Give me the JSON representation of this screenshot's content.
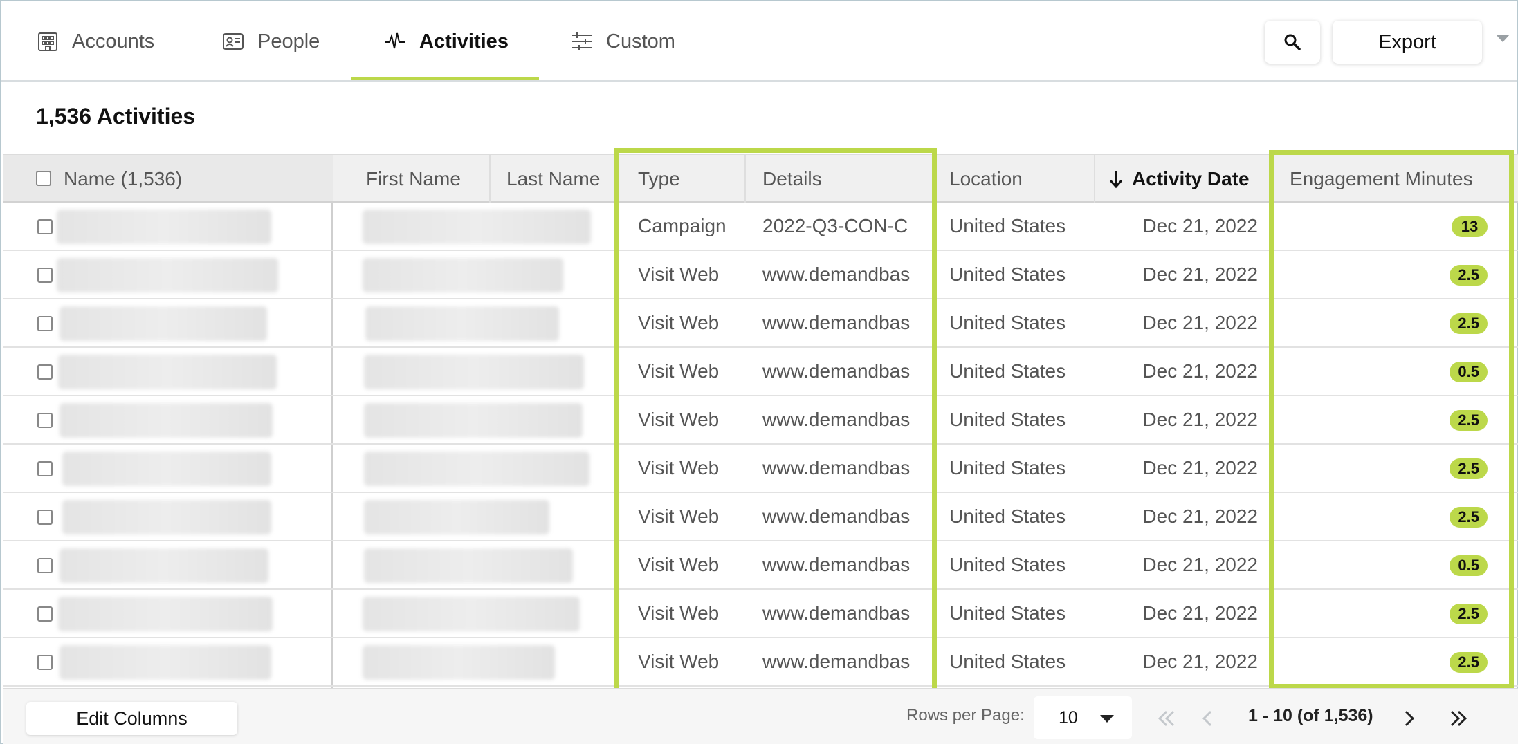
{
  "tabs": [
    {
      "label": "Accounts",
      "icon": "building-icon",
      "active": false
    },
    {
      "label": "People",
      "icon": "id-card-icon",
      "active": false
    },
    {
      "label": "Activities",
      "icon": "activity-pulse-icon",
      "active": true
    },
    {
      "label": "Custom",
      "icon": "sliders-icon",
      "active": false
    }
  ],
  "toolbar": {
    "export_label": "Export",
    "search_icon": "search-icon"
  },
  "page_title": "1,536 Activities",
  "columns": {
    "name": "Name (1,536)",
    "first_name": "First Name",
    "last_name": "Last Name",
    "type": "Type",
    "details": "Details",
    "location": "Location",
    "activity_date": "Activity Date",
    "engagement": "Engagement Minutes"
  },
  "sort": {
    "column": "Activity Date",
    "direction": "descending"
  },
  "rows": [
    {
      "type": "Campaign",
      "details": "2022-Q3-CON-C",
      "location": "United States",
      "date": "Dec 21, 2022",
      "minutes": "13"
    },
    {
      "type": "Visit Web",
      "details": "www.demandbas",
      "location": "United States",
      "date": "Dec 21, 2022",
      "minutes": "2.5"
    },
    {
      "type": "Visit Web",
      "details": "www.demandbas",
      "location": "United States",
      "date": "Dec 21, 2022",
      "minutes": "2.5"
    },
    {
      "type": "Visit Web",
      "details": "www.demandbas",
      "location": "United States",
      "date": "Dec 21, 2022",
      "minutes": "0.5"
    },
    {
      "type": "Visit Web",
      "details": "www.demandbas",
      "location": "United States",
      "date": "Dec 21, 2022",
      "minutes": "2.5"
    },
    {
      "type": "Visit Web",
      "details": "www.demandbas",
      "location": "United States",
      "date": "Dec 21, 2022",
      "minutes": "2.5"
    },
    {
      "type": "Visit Web",
      "details": "www.demandbas",
      "location": "United States",
      "date": "Dec 21, 2022",
      "minutes": "2.5"
    },
    {
      "type": "Visit Web",
      "details": "www.demandbas",
      "location": "United States",
      "date": "Dec 21, 2022",
      "minutes": "0.5"
    },
    {
      "type": "Visit Web",
      "details": "www.demandbas",
      "location": "United States",
      "date": "Dec 21, 2022",
      "minutes": "2.5"
    },
    {
      "type": "Visit Web",
      "details": "www.demandbas",
      "location": "United States",
      "date": "Dec 21, 2022",
      "minutes": "2.5"
    }
  ],
  "footer": {
    "edit_columns": "Edit Columns",
    "rows_per_page_label": "Rows per Page:",
    "rows_per_page_value": "10",
    "range": "1 - 10 (of 1,536)"
  },
  "colors": {
    "accent": "#bcd84a",
    "header_bg": "#f0f0f0",
    "text": "#555555"
  }
}
